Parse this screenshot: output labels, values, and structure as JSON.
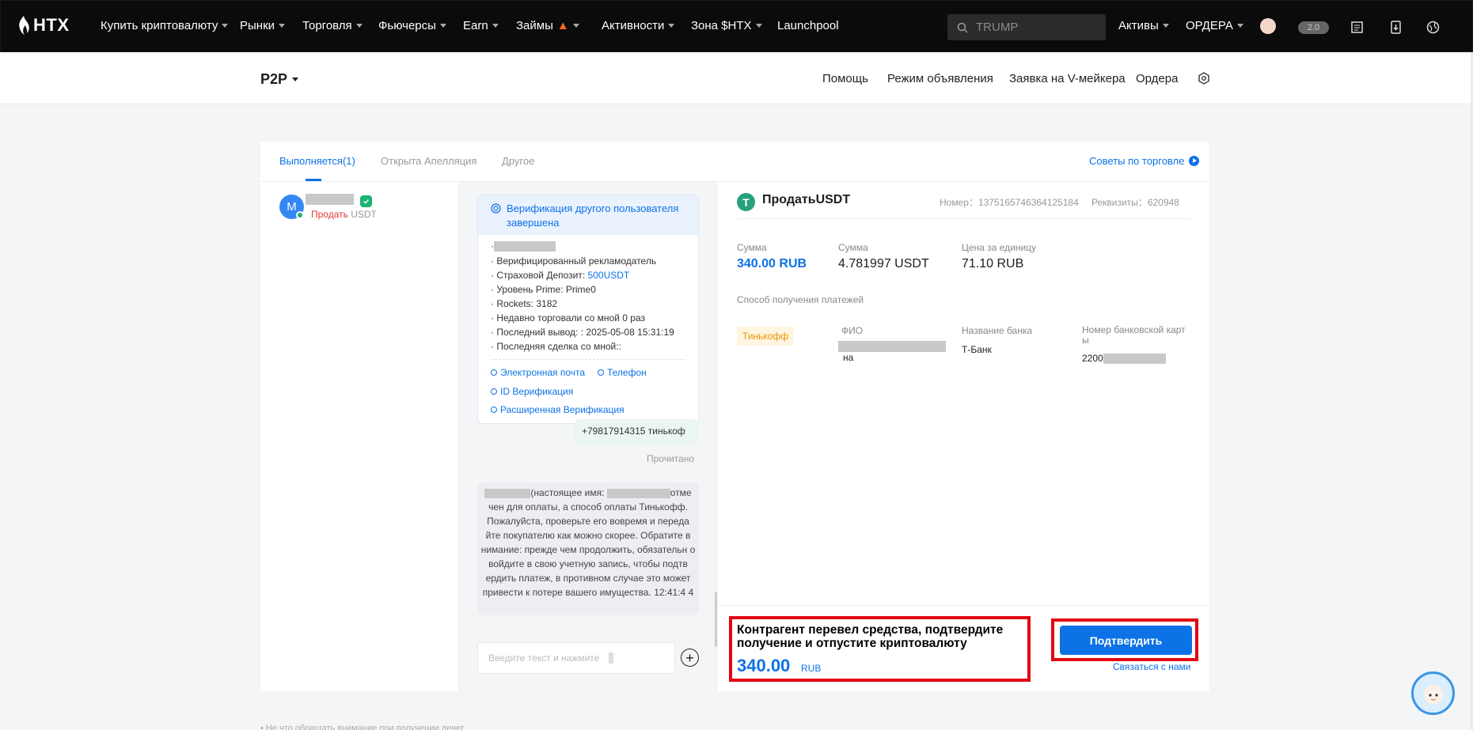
{
  "topnav": {
    "logo": "HTX",
    "items": [
      "Купить криптовалюту",
      "Рынки",
      "Торговля",
      "Фьючерсы",
      "Earn",
      "Займы",
      "Активности",
      "Зона $HTX",
      "Launchpool"
    ],
    "search_placeholder": "TRUMP",
    "assets": "Активы",
    "orders": "ОРДЕРА",
    "level_badge": "2.0"
  },
  "subnav": {
    "brand": "P2P",
    "links": [
      "Помощь",
      "Режим объявления",
      "Заявка на V-мейкера",
      "Ордера"
    ]
  },
  "tabs": {
    "items": [
      "Выполняется(1)",
      "Открыта Апелляция",
      "Другое"
    ],
    "active_index": 0,
    "tips_link": "Советы по торговле"
  },
  "order_list": {
    "avatar_letter": "M",
    "action": "Продать",
    "asset": "USDT"
  },
  "chat": {
    "verification_title": "Верификация другого пользователя завершена",
    "lines": {
      "verified": "· Верифицированный рекламодатель",
      "deposit_label": "· Страховой Депозит: ",
      "deposit_value": "500USDT",
      "prime": "· Уровень Prime: Prime0",
      "rockets": "· Rockets: 3182",
      "recent": "· Недавно торговали со мной 0 раз",
      "last_withdraw": "· Последний вывод: : 2025-05-08 15:31:19",
      "last_deal": "· Последняя сделка со мной::"
    },
    "badges": {
      "email": "Электронная почта",
      "phone": "Телефон",
      "id": "ID Верификация",
      "advanced": "Расширенная Верификация"
    },
    "peer_message": "+79817914315 тинькоф",
    "read_status": "Прочитано",
    "system_message_part1": "(настоящее имя: ",
    "system_message_part2": "отме чен для оплаты, а способ оплаты Тинькофф. Пожалуйста, проверьте его вовремя и переда йте покупателю как можно скорее. Обратите в нимание: прежде чем продолжить, обязательн о войдите в свою учетную запись, чтобы подтв ердить платеж, в противном случае это может привести к потере вашего имущества. 12:41:4 4",
    "input_placeholder": "Введите текст и нажмите"
  },
  "order": {
    "title": "ПродатьUSDT",
    "number_label": "Номер：",
    "number": "1375165746364125184",
    "details_label": "Реквизиты：",
    "details": "620948",
    "amount_label": "Сумма",
    "amount": "340.00 RUB",
    "quantity_label": "Сумма",
    "quantity": "4.781997 USDT",
    "price_label": "Цена за единицу",
    "price": "71.10 RUB",
    "payment_method_label": "Способ получения платежей",
    "payment_tag": "Тинькофф",
    "fio_label": "ФИО",
    "fio_suffix": "на",
    "bank_label": "Название банка",
    "bank": "Т-Банк",
    "card_label": "Номер банковской карт ы",
    "card_prefix": "2200"
  },
  "action": {
    "prompt": "Контрагент перевел средства, подтвердите получение и отпустите криптовалюту",
    "amount": "340.00",
    "currency": "RUB",
    "confirm_button": "Подтвердить",
    "contact_link": "Связаться с нами"
  },
  "footer_note": "• Не что обращать внимание при получении денег",
  "colors": {
    "accent": "#0d72e6",
    "highlight": "#e30613",
    "sell": "#e03a3a"
  }
}
